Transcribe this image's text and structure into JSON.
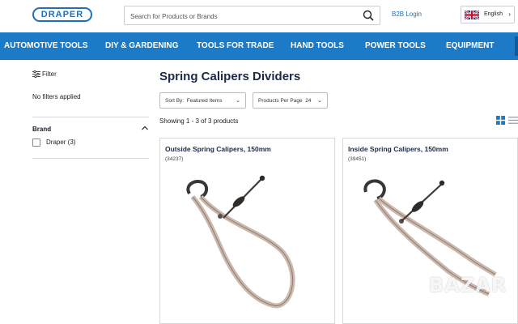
{
  "header": {
    "logo_text": "DRAPER",
    "search_placeholder": "Search for Products or Brands",
    "b2b_label": "B2B Login",
    "language": "English"
  },
  "nav": {
    "items": [
      "AUTOMOTIVE TOOLS",
      "DIY & GARDENING",
      "TOOLS FOR TRADE",
      "HAND TOOLS",
      "POWER TOOLS",
      "EQUIPMENT"
    ]
  },
  "sidebar": {
    "filter_label": "Filter",
    "no_filters": "No filters applied",
    "brand_title": "Brand",
    "brand_option": "Draper (3)"
  },
  "main": {
    "title": "Spring Calipers Dividers",
    "sort_label": "Sort By:",
    "sort_value": "Featured Items",
    "per_page_label": "Products Per Page",
    "per_page_value": "24",
    "showing": "Showing 1 - 3 of 3 products",
    "products": [
      {
        "name": "Outside Spring Calipers, 150mm",
        "code": "(34237)"
      },
      {
        "name": "Inside Spring Calipers, 150mm",
        "code": "(39451)"
      }
    ]
  },
  "colors": {
    "brand_blue": "#1d7ac7",
    "nav_blue": "#1d7ac7",
    "title_navy": "#1c2a4a"
  },
  "icons": [
    "search-icon",
    "uk-flag-icon",
    "chevron-down-icon",
    "filter-icon",
    "chevron-up-icon",
    "grid-view-icon",
    "list-view-icon"
  ],
  "watermark": "BAZAR"
}
